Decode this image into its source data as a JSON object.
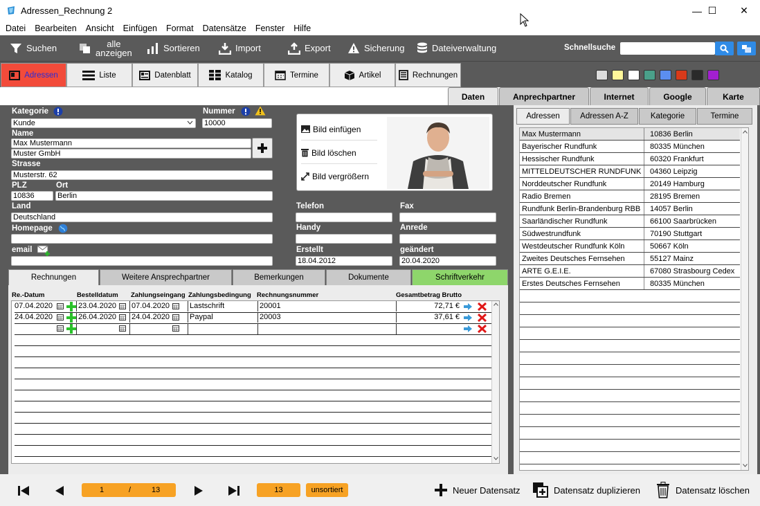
{
  "window": {
    "title": "Adressen_Rechnung 2",
    "minimize": "—",
    "maximize": "☐",
    "close": "✕"
  },
  "menu": [
    "Datei",
    "Bearbeiten",
    "Ansicht",
    "Einfügen",
    "Format",
    "Datensätze",
    "Fenster",
    "Hilfe"
  ],
  "toolbar": {
    "suchen": "Suchen",
    "alle_line1": "alle",
    "alle_line2": "anzeigen",
    "sortieren": "Sortieren",
    "import": "Import",
    "export": "Export",
    "sicherung": "Sicherung",
    "dateiverwaltung": "Dateiverwaltung",
    "schnellsuche": "Schnellsuche",
    "search_value": ""
  },
  "view_tabs": [
    "Adressen",
    "Liste",
    "Datenblatt",
    "Katalog",
    "Termine",
    "Artikel",
    "Rechnungen"
  ],
  "swatches": [
    "#dcdcdc",
    "#fff79a",
    "#ffffff",
    "#4aa08a",
    "#5b8ef0",
    "#d83a1a",
    "#2a2a2a",
    "#a21fd0"
  ],
  "sub_tabs": [
    "Daten",
    "Anprechpartner",
    "Internet",
    "Google",
    "Karte"
  ],
  "form": {
    "kategorie_label": "Kategorie",
    "kategorie_value": "Kunde",
    "nummer_label": "Nummer",
    "nummer_value": "10000",
    "name_label": "Name",
    "name1": "Max Mustermann",
    "name2": "Muster GmbH",
    "strasse_label": "Strasse",
    "strasse_value": "Musterstr. 62",
    "plz_label": "PLZ",
    "plz_value": "10836",
    "ort_label": "Ort",
    "ort_value": "Berlin",
    "land_label": "Land",
    "land_value": "Deutschland",
    "homepage_label": "Homepage",
    "homepage_value": "",
    "email_label": "email",
    "email_value": "",
    "telefon_label": "Telefon",
    "telefon_value": "",
    "fax_label": "Fax",
    "fax_value": "",
    "handy_label": "Handy",
    "handy_value": "",
    "anrede_label": "Anrede",
    "anrede_value": "",
    "erstellt_label": "Erstellt",
    "erstellt_value": "18.04.2012",
    "geaendert_label": "geändert",
    "geaendert_value": "20.04.2020"
  },
  "image_panel": {
    "insert": "Bild einfügen",
    "delete": "Bild löschen",
    "enlarge": "Bild vergrößern"
  },
  "bottom_tabs": [
    "Rechnungen",
    "Weitere Ansprechpartner",
    "Bemerkungen",
    "Dokumente",
    "Schriftverkehr"
  ],
  "invoices": {
    "headers": [
      "Re.-Datum",
      "Bestelldatum",
      "Zahlungseingang",
      "Zahlungsbedingung",
      "Rechnungsnummer",
      "Gesamtbetrag Brutto"
    ],
    "rows": [
      {
        "re_datum": "07.04.2020",
        "bestelldatum": "23.04.2020",
        "zahlungseingang": "07.04.2020",
        "bedingung": "Lastschrift",
        "nummer": "20001",
        "betrag": "72,71 €"
      },
      {
        "re_datum": "24.04.2020",
        "bestelldatum": "26.04.2020",
        "zahlungseingang": "24.04.2020",
        "bedingung": "Paypal",
        "nummer": "20003",
        "betrag": "37,61 €"
      }
    ]
  },
  "right_tabs": [
    "Adressen",
    "Adressen A-Z",
    "Kategorie",
    "Termine"
  ],
  "address_list": [
    {
      "name": "Max Mustermann",
      "city": "10836 Berlin"
    },
    {
      "name": "Bayerischer Rundfunk",
      "city": "80335 München"
    },
    {
      "name": "Hessischer Rundfunk",
      "city": "60320 Frankfurt"
    },
    {
      "name": "MITTELDEUTSCHER RUNDFUNK",
      "city": "04360 Leipzig"
    },
    {
      "name": "Norddeutscher Rundfunk",
      "city": "20149 Hamburg"
    },
    {
      "name": "Radio Bremen",
      "city": "28195 Bremen"
    },
    {
      "name": "Rundfunk Berlin-Brandenburg RBB",
      "city": "14057 Berlin"
    },
    {
      "name": "Saarländischer Rundfunk",
      "city": "66100 Saarbrücken"
    },
    {
      "name": "Südwestrundfunk",
      "city": "70190 Stuttgart"
    },
    {
      "name": "Westdeutscher Rundfunk Köln",
      "city": "50667 Köln"
    },
    {
      "name": "Zweites Deutsches Fernsehen",
      "city": "55127 Mainz"
    },
    {
      "name": "ARTE G.E.I.E.",
      "city": "67080 Strasbourg Cedex"
    },
    {
      "name": "Erstes Deutsches Fernsehen",
      "city": "80335 München"
    }
  ],
  "status": {
    "current": "1",
    "sep": "/",
    "total": "13",
    "count": "13",
    "sort": "unsortiert",
    "new": "Neuer Datensatz",
    "duplicate": "Datensatz duplizieren",
    "delete": "Datensatz löschen"
  }
}
